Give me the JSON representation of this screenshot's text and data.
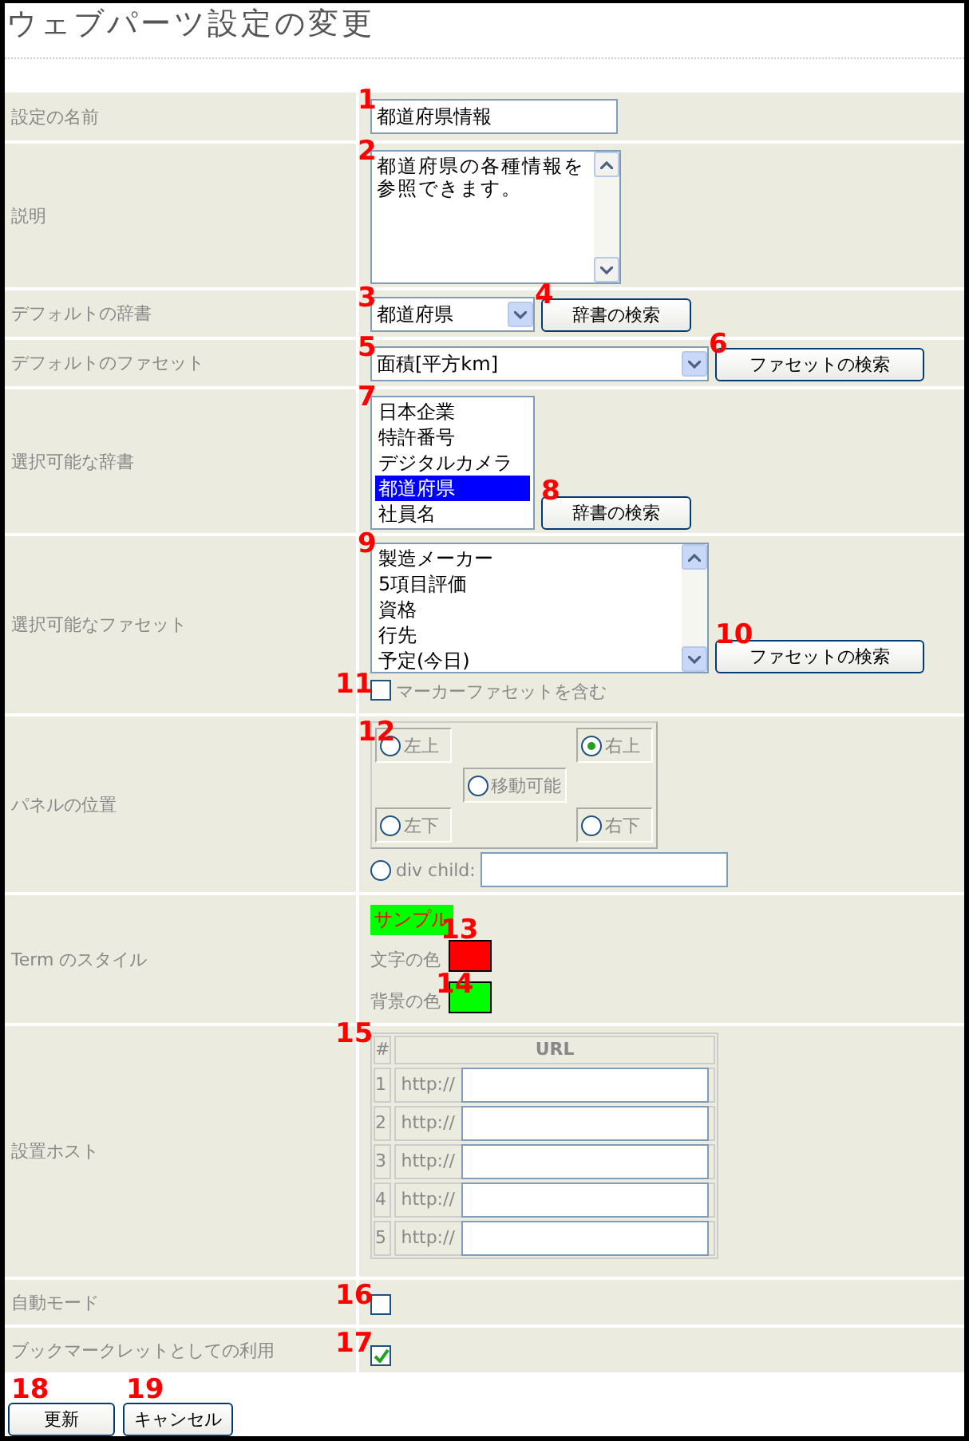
{
  "page_title": "ウェブパーツ設定の変更",
  "rows": [
    {
      "kind": "text",
      "label": "設定の名前",
      "marker": "1",
      "value": "都道府県情報"
    },
    {
      "kind": "textarea",
      "label": "説明",
      "marker": "2",
      "value": "都道府県の各種情報を参照できます。"
    },
    {
      "kind": "select",
      "label": "デフォルトの辞書",
      "marker": "3",
      "value": "都道府県",
      "button": {
        "label": "辞書の検索",
        "marker": "4"
      }
    },
    {
      "kind": "select",
      "label": "デフォルトのファセット",
      "marker": "5",
      "value": "面積[平方km]",
      "button": {
        "label": "ファセットの検索",
        "marker": "6"
      }
    },
    {
      "kind": "listbox",
      "label": "選択可能な辞書",
      "marker": "7",
      "options": [
        {
          "label": "日本企業",
          "selected": false
        },
        {
          "label": "特許番号",
          "selected": false
        },
        {
          "label": "デジタルカメラ",
          "selected": false
        },
        {
          "label": "都道府県",
          "selected": true
        },
        {
          "label": "社員名",
          "selected": false
        }
      ],
      "button": {
        "label": "辞書の検索",
        "marker": "8"
      }
    },
    {
      "kind": "listbox",
      "label": "選択可能なファセット",
      "marker": "9",
      "options": [
        {
          "label": "製造メーカー",
          "selected": false
        },
        {
          "label": "5項目評価",
          "selected": false
        },
        {
          "label": "資格",
          "selected": false
        },
        {
          "label": "行先",
          "selected": false
        },
        {
          "label": "予定(今日)",
          "selected": false
        }
      ],
      "button": {
        "label": "ファセットの検索",
        "marker": "10"
      },
      "checkbox": {
        "label": "マーカーファセットを含む",
        "checked": false,
        "marker": "11"
      }
    },
    {
      "kind": "position",
      "label": "パネルの位置",
      "marker": "12",
      "positions": [
        {
          "label": "左上",
          "selected": false
        },
        {
          "label": "右上",
          "selected": true
        },
        {
          "label": "移動可能",
          "selected": false
        },
        {
          "label": "左下",
          "selected": false
        },
        {
          "label": "右下",
          "selected": false
        }
      ],
      "div_child": {
        "label": "div child:",
        "selected": false
      }
    },
    {
      "kind": "style",
      "label": "Term のスタイル",
      "sample": "サンプル",
      "swatches": [
        {
          "label": "文字の色",
          "color": "#ff0000",
          "marker": "13"
        },
        {
          "label": "背景の色",
          "color": "#00ff00",
          "marker": "14"
        }
      ]
    },
    {
      "kind": "hosts",
      "label": "設置ホスト",
      "marker": "15",
      "columns": [
        "#",
        "URL"
      ],
      "hosts": [
        {
          "number": "1",
          "prefix": "http://"
        },
        {
          "number": "2",
          "prefix": "http://"
        },
        {
          "number": "3",
          "prefix": "http://"
        },
        {
          "number": "4",
          "prefix": "http://"
        },
        {
          "number": "5",
          "prefix": "http://"
        }
      ]
    },
    {
      "kind": "checkbox",
      "label": "自動モード",
      "marker": "16",
      "checked": false
    },
    {
      "kind": "checkbox",
      "label": "ブックマークレットとしての利用",
      "marker": "17",
      "checked": true
    }
  ],
  "buttons": [
    {
      "label": "更新",
      "marker": "18"
    },
    {
      "label": "キャンセル",
      "marker": "19"
    }
  ]
}
